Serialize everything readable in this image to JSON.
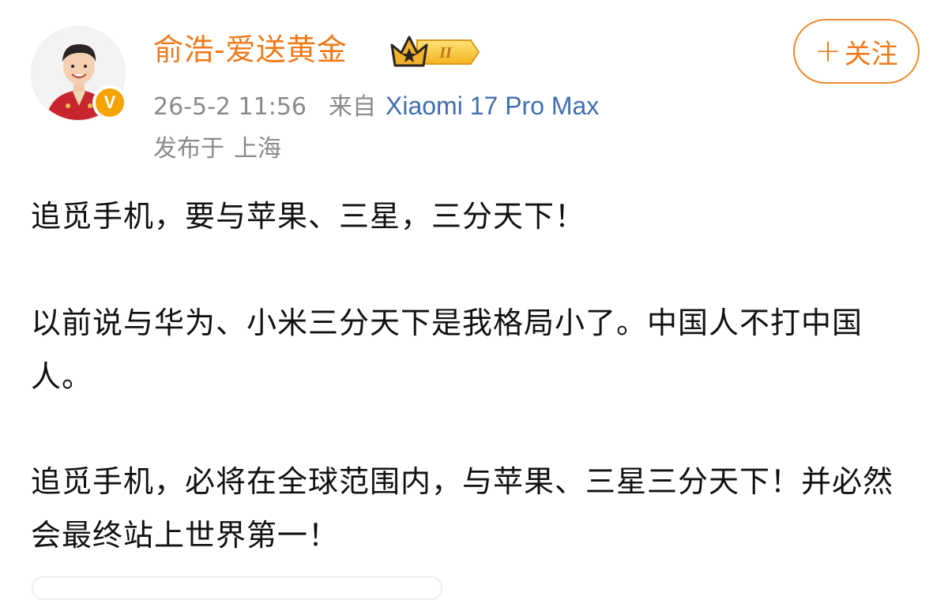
{
  "header": {
    "username": "俞浩-爱送黄金",
    "vip_level": "II",
    "follow_label": "关注",
    "follow_plus": "+",
    "timestamp": "26-5-2 11:56",
    "source_prefix": "来自",
    "device": "Xiaomi 17 Pro Max",
    "location_prefix": "发布于",
    "location": "上海",
    "verified_mark": "V"
  },
  "post": {
    "paragraph1": "追觅手机，要与苹果、三星，三分天下！",
    "paragraph2": "以前说与华为、小米三分天下是我格局小了。中国人不打中国人。",
    "paragraph3": "追觅手机，必将在全球范围内，与苹果、三星三分天下！并必然会最终站上世界第一！"
  },
  "colors": {
    "username": "#f07a1a",
    "follow_border": "#f08a2a",
    "meta_gray": "#8a8a8a",
    "device_blue": "#3f6fb0",
    "verified_gold": "#f5a300"
  },
  "icons": {
    "avatar": "user-avatar-photo",
    "verified": "verified-v-icon",
    "vip": "crown-vip-icon"
  }
}
